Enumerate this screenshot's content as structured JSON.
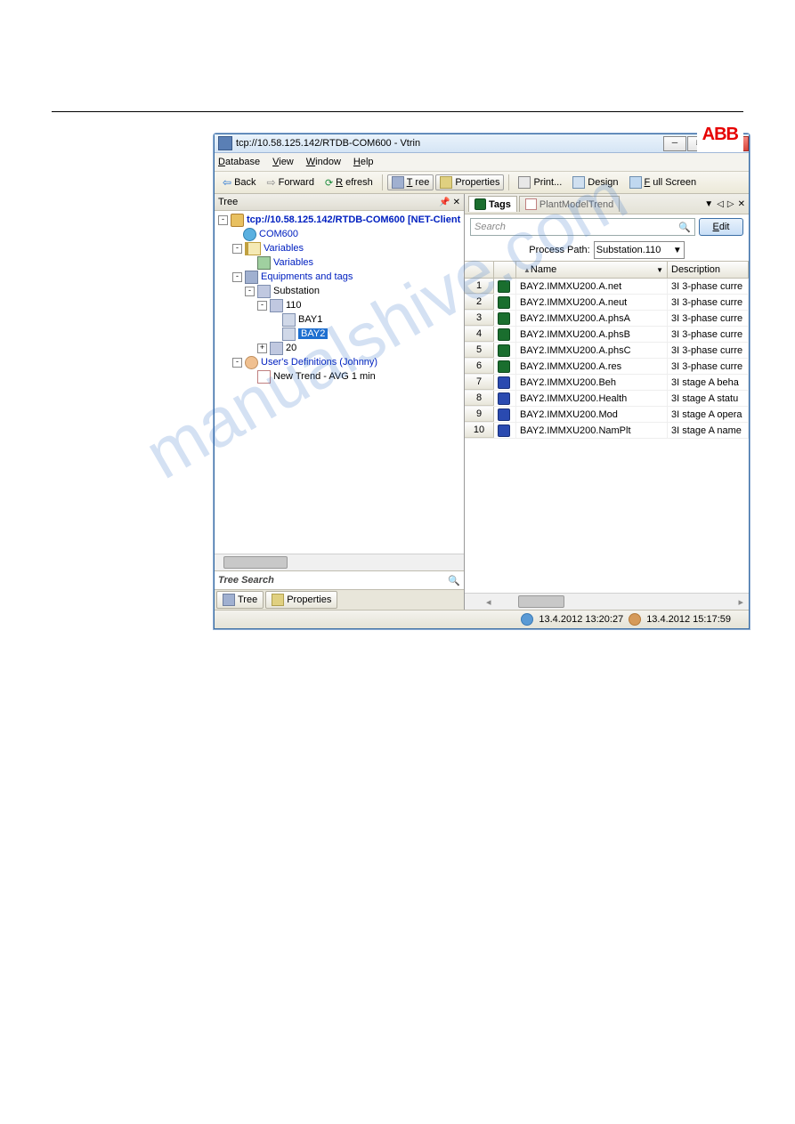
{
  "window": {
    "title": "tcp://10.58.125.142/RTDB-COM600 - Vtrin"
  },
  "menu": {
    "database": "Database",
    "view": "View",
    "window": "Window",
    "help": "Help"
  },
  "toolbar": {
    "back": "Back",
    "forward": "Forward",
    "refresh": "Refresh",
    "tree": "Tree",
    "properties": "Properties",
    "print": "Print...",
    "design": "Design",
    "fullscreen": "Full Screen"
  },
  "logo": "ABB",
  "tree": {
    "header": "Tree",
    "root": "tcp://10.58.125.142/RTDB-COM600 [NET-Client",
    "com600": "COM600",
    "variables_folder": "Variables",
    "variables_item": "Variables",
    "equipments": "Equipments and tags",
    "substation": "Substation",
    "n110": "110",
    "bay1": "BAY1",
    "bay2": "BAY2",
    "n20": "20",
    "users": "User's Definitions (Johnny)",
    "trend": "New Trend - AVG 1 min",
    "search_label": "Tree Search",
    "tab_tree": "Tree",
    "tab_props": "Properties"
  },
  "right": {
    "tab_tags": "Tags",
    "tab_trend": "PlantModelTrend",
    "search_placeholder": "Search",
    "edit_btn": "Edit",
    "path_label": "Process Path:",
    "path_value": "Substation.110",
    "col_name": "Name",
    "col_desc": "Description",
    "rows": [
      {
        "n": "1",
        "name": "BAY2.IMMXU200.A.net",
        "desc": "3I 3-phase curre",
        "icon": "green"
      },
      {
        "n": "2",
        "name": "BAY2.IMMXU200.A.neut",
        "desc": "3I 3-phase curre",
        "icon": "green"
      },
      {
        "n": "3",
        "name": "BAY2.IMMXU200.A.phsA",
        "desc": "3I 3-phase curre",
        "icon": "green"
      },
      {
        "n": "4",
        "name": "BAY2.IMMXU200.A.phsB",
        "desc": "3I 3-phase curre",
        "icon": "green"
      },
      {
        "n": "5",
        "name": "BAY2.IMMXU200.A.phsC",
        "desc": "3I 3-phase curre",
        "icon": "green"
      },
      {
        "n": "6",
        "name": "BAY2.IMMXU200.A.res",
        "desc": "3I 3-phase curre",
        "icon": "green"
      },
      {
        "n": "7",
        "name": "BAY2.IMMXU200.Beh",
        "desc": "3I stage A beha",
        "icon": "blue"
      },
      {
        "n": "8",
        "name": "BAY2.IMMXU200.Health",
        "desc": "3I stage A statu",
        "icon": "blue"
      },
      {
        "n": "9",
        "name": "BAY2.IMMXU200.Mod",
        "desc": "3I stage A opera",
        "icon": "blue"
      },
      {
        "n": "10",
        "name": "BAY2.IMMXU200.NamPlt",
        "desc": "3I stage A name",
        "icon": "blue"
      }
    ]
  },
  "status": {
    "time1": "13.4.2012 13:20:27",
    "time2": "13.4.2012 15:17:59"
  },
  "watermark": "manualshive.com"
}
